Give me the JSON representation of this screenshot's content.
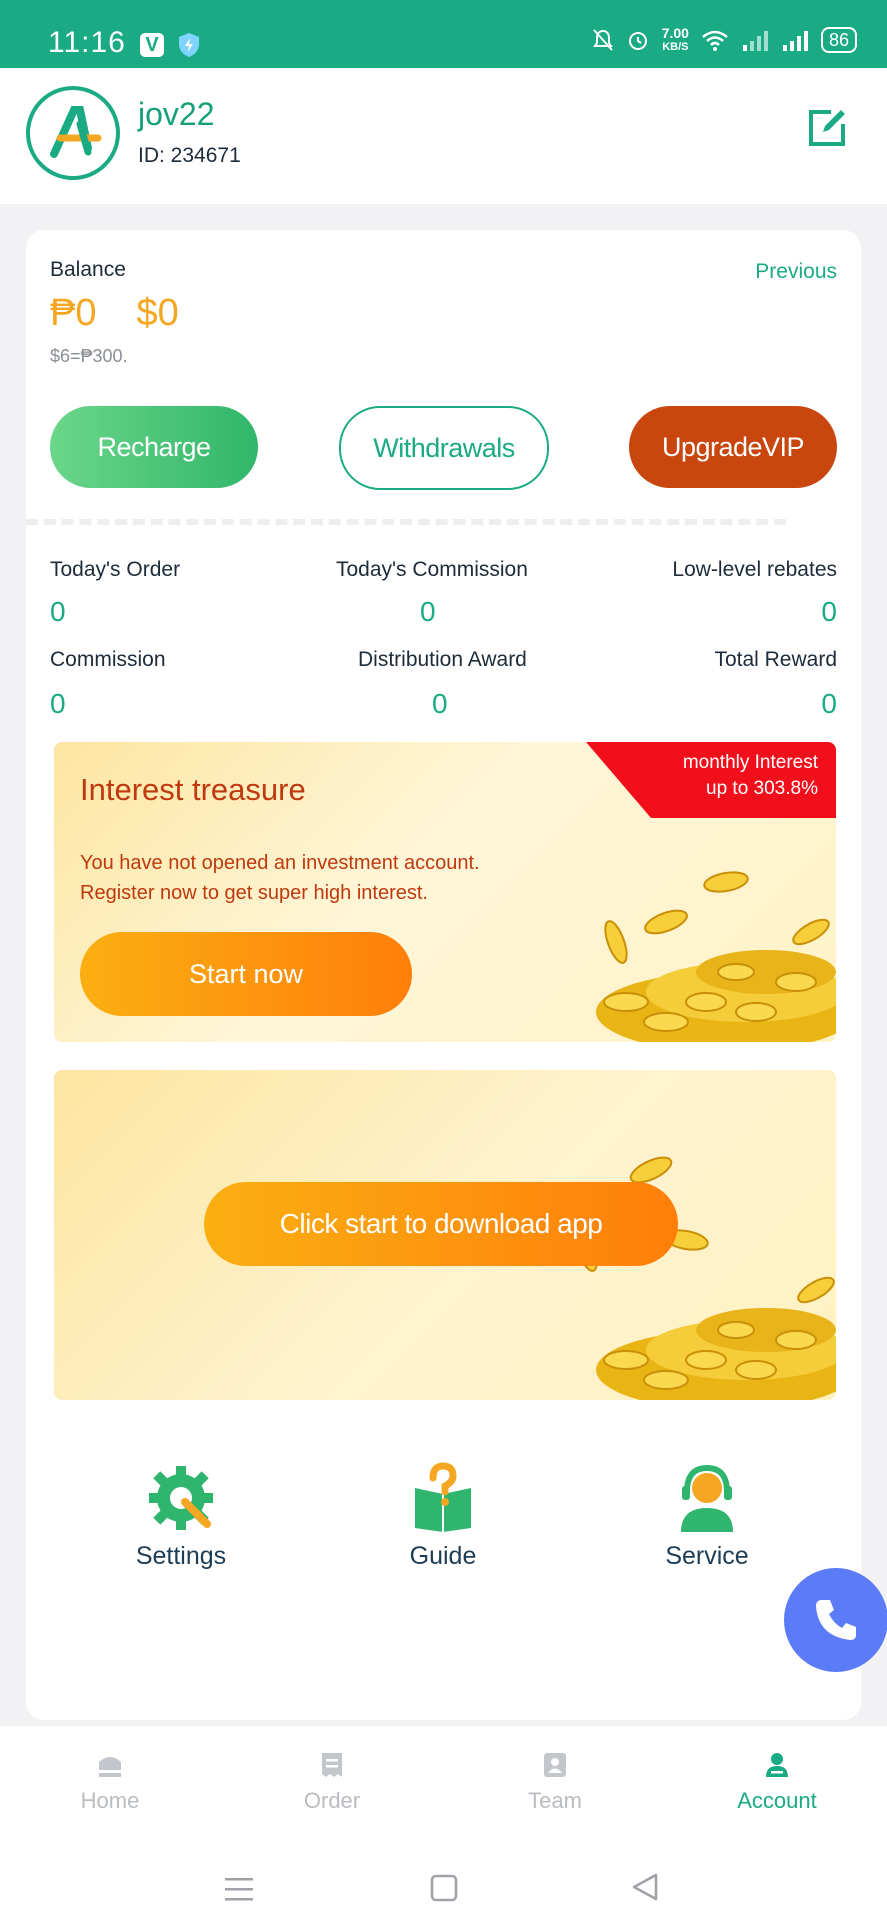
{
  "status_bar": {
    "time": "11:16",
    "net_speed": "7.00",
    "net_unit": "KB/S",
    "battery": "86"
  },
  "header": {
    "username": "jov22",
    "user_id": "ID: 234671"
  },
  "balance": {
    "label": "Balance",
    "previous": "Previous",
    "peso": "₱0",
    "dollar": "$0",
    "rate": "$6=₱300."
  },
  "actions": {
    "recharge": "Recharge",
    "withdrawals": "Withdrawals",
    "upgrade": "UpgradeVIP"
  },
  "stats": [
    {
      "label": "Today's Order",
      "value": "0"
    },
    {
      "label": "Today's Commission",
      "value": "0"
    },
    {
      "label": "Low-level rebates",
      "value": "0"
    },
    {
      "label": "Commission",
      "value": "0"
    },
    {
      "label": "Distribution Award",
      "value": "0"
    },
    {
      "label": "Total Reward",
      "value": "0"
    }
  ],
  "interest": {
    "tag_line1": "monthly Interest",
    "tag_line2": "up to 303.8%",
    "title": "Interest treasure",
    "desc_line1": "You have not opened an investment account.",
    "desc_line2": "Register now to get super high interest.",
    "button": "Start now"
  },
  "download": {
    "button": "Click start to download app"
  },
  "shortcuts": {
    "settings": "Settings",
    "guide": "Guide",
    "service": "Service"
  },
  "nav": {
    "home": "Home",
    "order": "Order",
    "team": "Team",
    "account": "Account"
  },
  "colors": {
    "brand_green": "#1aab84",
    "accent_orange": "#f5a623",
    "vip_red": "#c9460e",
    "tag_red": "#f10f1c",
    "fab_blue": "#5b7cf6"
  }
}
